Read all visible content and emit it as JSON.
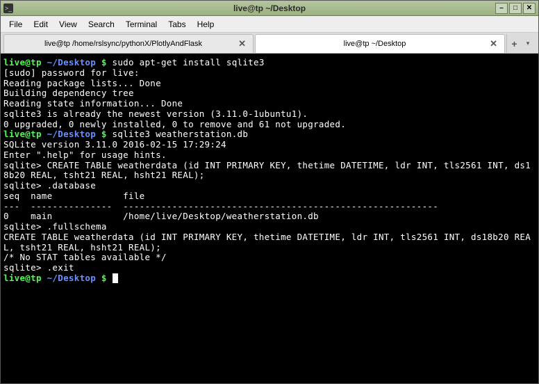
{
  "window": {
    "title": "live@tp ~/Desktop"
  },
  "menu": {
    "file": "File",
    "edit": "Edit",
    "view": "View",
    "search": "Search",
    "terminal": "Terminal",
    "tabs": "Tabs",
    "help": "Help"
  },
  "tabs": [
    {
      "label": "live@tp /home/rslsync/pythonX/PlotlyAndFlask",
      "active": false
    },
    {
      "label": "live@tp ~/Desktop",
      "active": true
    }
  ],
  "icons": {
    "minimize": "–",
    "maximize": "□",
    "close_window": "✕",
    "close_tab": "✕",
    "add_tab": "+",
    "dropdown": "▾",
    "app": ">_"
  },
  "terminal": {
    "prompt_user": "live@tp",
    "prompt_path": "~/Desktop",
    "prompt_dollar": "$",
    "cmd1": "sudo apt-get install sqlite3",
    "out1": "[sudo] password for live:\nReading package lists... Done\nBuilding dependency tree\nReading state information... Done\nsqlite3 is already the newest version (3.11.0-1ubuntu1).\n0 upgraded, 0 newly installed, 0 to remove and 61 not upgraded.",
    "cmd2": "sqlite3 weatherstation.db",
    "out2": "SQLite version 3.11.0 2016-02-15 17:29:24\nEnter \".help\" for usage hints.\nsqlite> CREATE TABLE weatherdata (id INT PRIMARY KEY, thetime DATETIME, ldr INT, tls2561 INT, ds18b20 REAL, tsht21 REAL, hsht21 REAL);\nsqlite> .database\nseq  name             file\n---  ---------------  ----------------------------------------------------------\n0    main             /home/live/Desktop/weatherstation.db\nsqlite> .fullschema\nCREATE TABLE weatherdata (id INT PRIMARY KEY, thetime DATETIME, ldr INT, tls2561 INT, ds18b20 REAL, tsht21 REAL, hsht21 REAL);\n/* No STAT tables available */\nsqlite> .exit"
  }
}
